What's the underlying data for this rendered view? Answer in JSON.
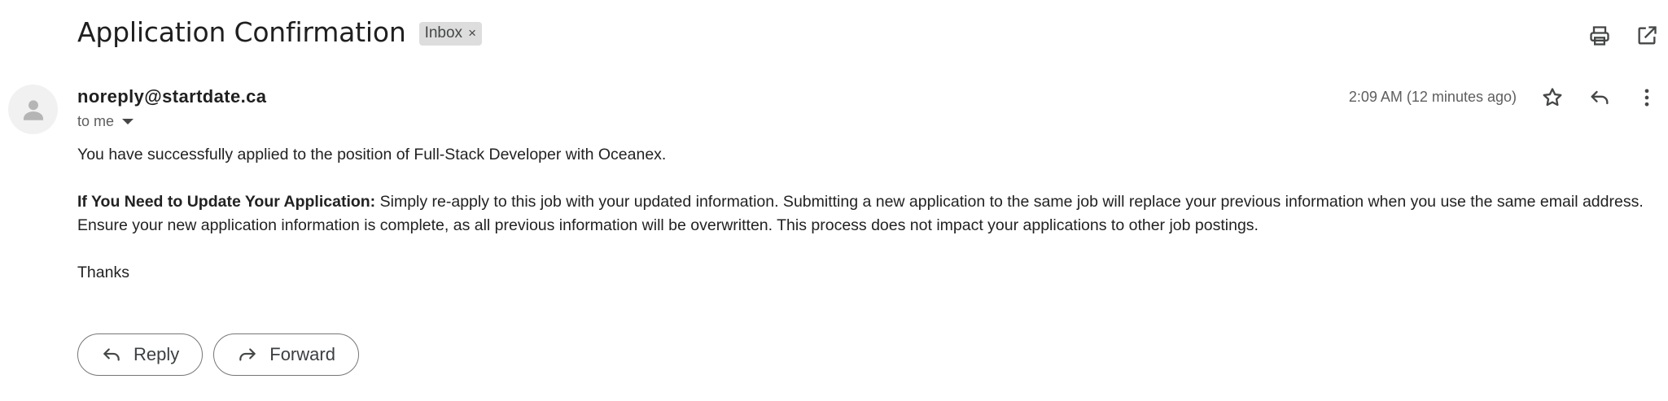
{
  "email": {
    "subject": "Application Confirmation",
    "label": "Inbox",
    "label_remove": "×",
    "sender": "noreply@startdate.ca",
    "recipient": "to me",
    "timestamp": "2:09 AM (12 minutes ago)",
    "body": {
      "line1": "You have successfully applied to the position of Full-Stack Developer with Oceanex.",
      "update_heading": "If You Need to Update Your Application:",
      "update_text": " Simply re-apply to this job with your updated information. Submitting a new application to the same job will replace your previous information when you use the same email address. Ensure your new application information is complete, as all previous information will be overwritten. This process does not impact your applications to other job postings.",
      "signoff": "Thanks"
    }
  },
  "actions": {
    "reply_label": "Reply",
    "forward_label": "Forward"
  },
  "icons": {
    "print": "print-icon",
    "open_new_window": "open-in-new-window-icon",
    "star": "star-icon",
    "reply": "reply-icon",
    "more": "more-vert-icon",
    "forward": "forward-icon",
    "avatar": "person-icon"
  }
}
